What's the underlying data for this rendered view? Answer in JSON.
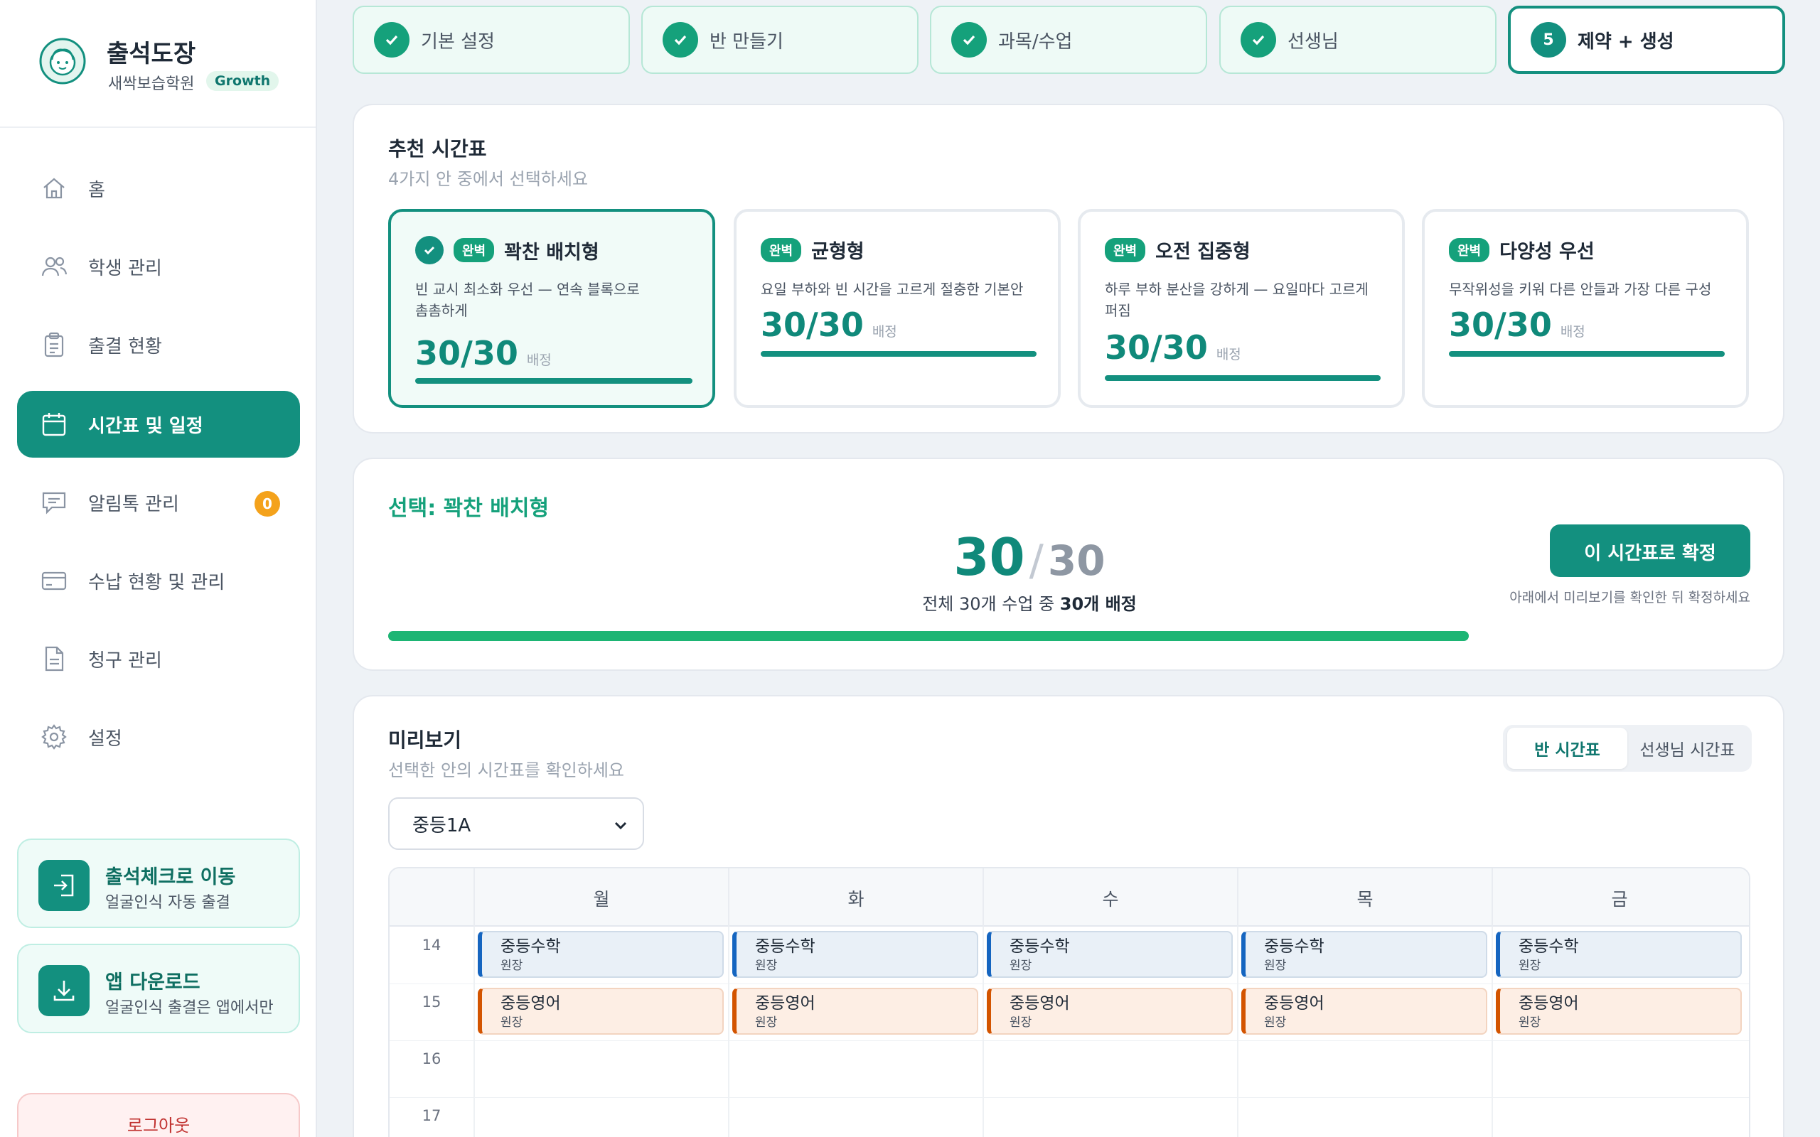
{
  "brand": {
    "name": "출석도장",
    "academy": "새싹보습학원",
    "plan": "Growth"
  },
  "nav": {
    "items": [
      {
        "label": "홈"
      },
      {
        "label": "학생 관리"
      },
      {
        "label": "출결 현황"
      },
      {
        "label": "시간표 및 일정"
      },
      {
        "label": "알림톡 관리",
        "badge": "0"
      },
      {
        "label": "수납 현황 및 관리"
      },
      {
        "label": "청구 관리"
      },
      {
        "label": "설정"
      }
    ],
    "active": "시간표 및 일정"
  },
  "promos": [
    {
      "title": "출석체크로 이동",
      "subtitle": "얼굴인식 자동 출결"
    },
    {
      "title": "앱 다운로드",
      "subtitle": "얼굴인식 출결은 앱에서만"
    }
  ],
  "logout_label": "로그아웃",
  "steps": [
    {
      "label": "기본 설정",
      "done": true
    },
    {
      "label": "반 만들기",
      "done": true
    },
    {
      "label": "과목/수업",
      "done": true
    },
    {
      "label": "선생님",
      "done": true
    },
    {
      "label": "제약 + 생성",
      "number": "5",
      "active": true
    }
  ],
  "recommend": {
    "title": "추천 시간표",
    "subtitle": "4가지 안 중에서 선택하세요",
    "options": [
      {
        "badge": "완벽",
        "name": "꽉찬 배치형",
        "desc_line1": "빈 교시 최소화 우선 — 연속 블록으로",
        "desc_line2": "촘촘하게",
        "score": "30/30",
        "unit": "배정",
        "fill": 1.0,
        "selected": true
      },
      {
        "badge": "완벽",
        "name": "균형형",
        "desc_line1": "요일 부하와 빈 시간을 고르게 절충한 기본안",
        "desc_line2": "",
        "score": "30/30",
        "unit": "배정",
        "fill": 1.0
      },
      {
        "badge": "완벽",
        "name": "오전 집중형",
        "desc_line1": "하루 부하 분산을 강하게 — 요일마다 고르게",
        "desc_line2": "퍼짐",
        "score": "30/30",
        "unit": "배정",
        "fill": 1.0
      },
      {
        "badge": "완벽",
        "name": "다양성 우선",
        "desc_line1": "무작위성을 키워 다른 안들과 가장 다른 구성",
        "desc_line2": "",
        "score": "30/30",
        "unit": "배정",
        "fill": 1.0
      }
    ]
  },
  "summary": {
    "label": "선택: 꽉찬 배치형",
    "assigned": "30",
    "slash": "/",
    "total": "30",
    "line_prefix": "전체 30개 수업 중 ",
    "line_bold": "30개 배정",
    "progress": 1.0,
    "confirm_label": "이 시간표로 확정",
    "confirm_hint": "아래에서 미리보기를 확인한 뒤 확정하세요",
    "colors": {
      "accent": "#13907f",
      "progress": "#1db574"
    }
  },
  "preview": {
    "title": "미리보기",
    "subtitle": "선택한 안의 시간표를 확인하세요",
    "tabs": [
      {
        "label": "반 시간표",
        "active": true
      },
      {
        "label": "선생님 시간표"
      }
    ],
    "selected_class": "중등1A",
    "days": [
      "월",
      "화",
      "수",
      "목",
      "금"
    ],
    "hours": [
      "14",
      "15",
      "16",
      "17"
    ],
    "lessons": [
      {
        "day": 0,
        "hour": 0,
        "name": "중등수학",
        "teacher": "원장",
        "kind": "math"
      },
      {
        "day": 1,
        "hour": 0,
        "name": "중등수학",
        "teacher": "원장",
        "kind": "math"
      },
      {
        "day": 2,
        "hour": 0,
        "name": "중등수학",
        "teacher": "원장",
        "kind": "math"
      },
      {
        "day": 3,
        "hour": 0,
        "name": "중등수학",
        "teacher": "원장",
        "kind": "math"
      },
      {
        "day": 4,
        "hour": 0,
        "name": "중등수학",
        "teacher": "원장",
        "kind": "math"
      },
      {
        "day": 0,
        "hour": 1,
        "name": "중등영어",
        "teacher": "원장",
        "kind": "eng"
      },
      {
        "day": 1,
        "hour": 1,
        "name": "중등영어",
        "teacher": "원장",
        "kind": "eng"
      },
      {
        "day": 2,
        "hour": 1,
        "name": "중등영어",
        "teacher": "원장",
        "kind": "eng"
      },
      {
        "day": 3,
        "hour": 1,
        "name": "중등영어",
        "teacher": "원장",
        "kind": "eng"
      },
      {
        "day": 4,
        "hour": 1,
        "name": "중등영어",
        "teacher": "원장",
        "kind": "eng"
      }
    ]
  }
}
